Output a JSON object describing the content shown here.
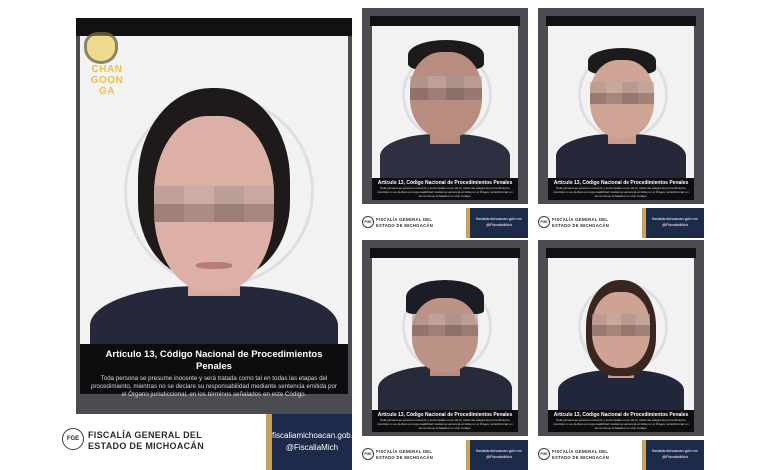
{
  "watermark": {
    "lines": [
      "CHAN",
      "GOON",
      "GA"
    ],
    "icon": "coffee-cup-icon"
  },
  "legal": {
    "title": "Artículo 13, Código Nacional de Procedimientos Penales",
    "body": "Toda persona se presume inocente y será tratada como tal en todas las etapas del procedimiento, mientras no se declare su responsabilidad mediante sentencia emitida por el Órgano jurisdiccional, en los términos señalados en este Código."
  },
  "footer": {
    "logo_text": "FGE",
    "org_line1": "FISCALÍA GENERAL DEL",
    "org_line2": "ESTADO DE MICHOACÁN",
    "site": "fiscaliamichoacan.gob.mx",
    "social": "@FiscaliaMich"
  },
  "colors": {
    "frame": "#4a4c52",
    "topbar": "#111114",
    "legal_bg": "#0d0d10",
    "gold": "#c9a15a",
    "navy": "#1d2a4a",
    "uniform": "#24283a"
  }
}
